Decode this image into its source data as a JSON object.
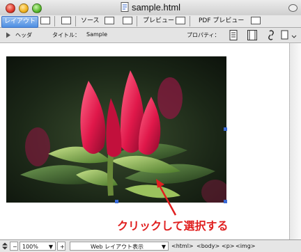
{
  "window": {
    "title": "sample.html"
  },
  "tabs": [
    {
      "label": "レイアウト",
      "active": true
    },
    {
      "label": "ソース",
      "active": false
    },
    {
      "label": "プレビュー",
      "active": false
    },
    {
      "label": "PDF プレビュー",
      "active": false
    }
  ],
  "propbar": {
    "header_label": "ヘッダ",
    "title_label": "タイトル：",
    "title_value": "Sample",
    "properties_label": "プロパティ："
  },
  "annotation": {
    "text": "クリックして選択する"
  },
  "statusbar": {
    "zoom": "100%",
    "view_mode": "Web レイアウト表示",
    "tag_path": [
      "<html>",
      "<body>",
      "<p>",
      "<img>"
    ]
  },
  "colors": {
    "tab_active": "#4d8ee3",
    "annotation": "#e02020",
    "selection_handle": "#3b6bd6"
  }
}
